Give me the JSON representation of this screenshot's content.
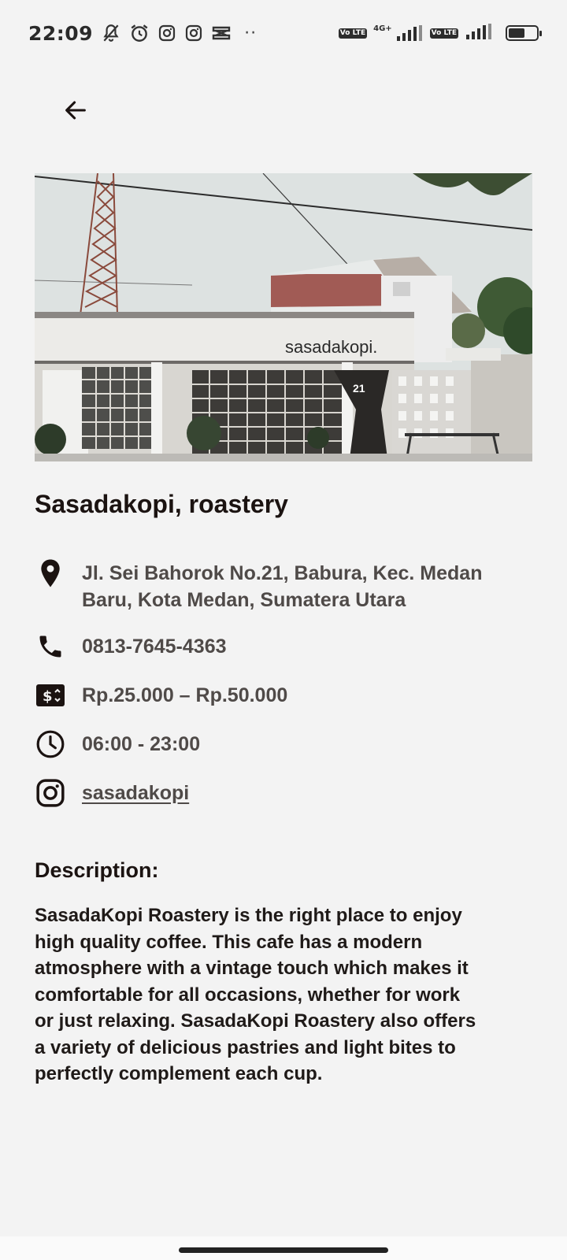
{
  "status_bar": {
    "time": "22:09",
    "icons": [
      "notifications-muted-icon",
      "alarm-icon",
      "instagram-icon",
      "instagram-icon",
      "capcut-icon"
    ],
    "more": "··",
    "network_1": "4G+",
    "volte_label": "Vo LTE",
    "battery_level": 0.6
  },
  "header": {
    "back_icon": "arrow-left-icon"
  },
  "hero": {
    "sign_text": "sasadakopi.",
    "house_number": "21"
  },
  "place": {
    "name": "Sasadakopi, roastery",
    "address_line1": "Jl. Sei Bahorok No.21, Babura, Kec. Medan",
    "address_line2": "Baru, Kota Medan, Sumatera Utara",
    "phone": "0813-7645-4363",
    "price_range": "Rp.25.000 – Rp.50.000",
    "hours": "06:00 - 23:00",
    "instagram": "sasadakopi"
  },
  "description": {
    "heading": "Description:",
    "lines": [
      "SasadaKopi Roastery is the right place to enjoy",
      "high quality coffee. This cafe has a modern",
      "atmosphere with a vintage touch which makes it",
      "comfortable for all occasions, whether for work",
      "or just relaxing. SasadaKopi Roastery also offers",
      "a variety of delicious pastries and light bites to",
      "perfectly complement each cup."
    ]
  },
  "colors": {
    "background": "#f3f3f3",
    "text_dark": "#1b1311",
    "text_muted": "#4f4a48"
  }
}
